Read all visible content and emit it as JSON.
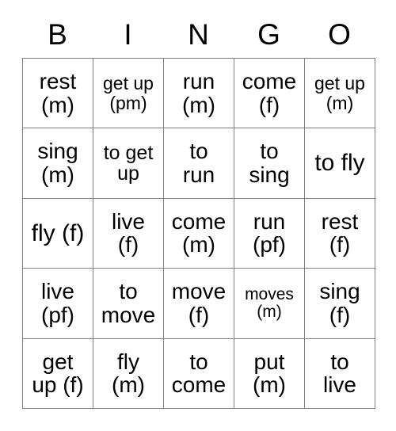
{
  "card": {
    "title": "BINGO",
    "headers": [
      "B",
      "I",
      "N",
      "G",
      "O"
    ],
    "rows": [
      [
        {
          "line1": "rest",
          "line2": "(m)",
          "size": "fs-lg"
        },
        {
          "line1": "get up",
          "line2": "(pm)",
          "size": "fs-sm"
        },
        {
          "line1": "run",
          "line2": "(m)",
          "size": "fs-lg"
        },
        {
          "line1": "come",
          "line2": "(f)",
          "size": "fs-lg"
        },
        {
          "line1": "get up",
          "line2": "(m)",
          "size": "fs-sm"
        }
      ],
      [
        {
          "line1": "sing",
          "line2": "(m)",
          "size": "fs-lg"
        },
        {
          "line1": "to get",
          "line2": "up",
          "size": "fs-md"
        },
        {
          "line1": "to",
          "line2": "run",
          "size": "fs-lg"
        },
        {
          "line1": "to",
          "line2": "sing",
          "size": "fs-lg"
        },
        {
          "line1": "to fly",
          "line2": "",
          "size": "fs-xl"
        }
      ],
      [
        {
          "line1": "fly (f)",
          "line2": "",
          "size": "fs-xl"
        },
        {
          "line1": "live",
          "line2": "(f)",
          "size": "fs-lg"
        },
        {
          "line1": "come",
          "line2": "(m)",
          "size": "fs-lg"
        },
        {
          "line1": "run",
          "line2": "(pf)",
          "size": "fs-lg"
        },
        {
          "line1": "rest",
          "line2": "(f)",
          "size": "fs-lg"
        }
      ],
      [
        {
          "line1": "live",
          "line2": "(pf)",
          "size": "fs-lg"
        },
        {
          "line1": "to",
          "line2": "move",
          "size": "fs-lg"
        },
        {
          "line1": "move",
          "line2": "(f)",
          "size": "fs-lg"
        },
        {
          "line1": "moves",
          "line2": "(m)",
          "size": "fs-xs"
        },
        {
          "line1": "sing",
          "line2": "(f)",
          "size": "fs-lg"
        }
      ],
      [
        {
          "line1": "get",
          "line2": "up (f)",
          "size": "fs-lg"
        },
        {
          "line1": "fly",
          "line2": "(m)",
          "size": "fs-lg"
        },
        {
          "line1": "to",
          "line2": "come",
          "size": "fs-lg"
        },
        {
          "line1": "put",
          "line2": "(m)",
          "size": "fs-lg"
        },
        {
          "line1": "to",
          "line2": "live",
          "size": "fs-lg"
        }
      ]
    ],
    "colors": {
      "background": "#ffffff",
      "text": "#000000",
      "border": "#808080"
    }
  }
}
